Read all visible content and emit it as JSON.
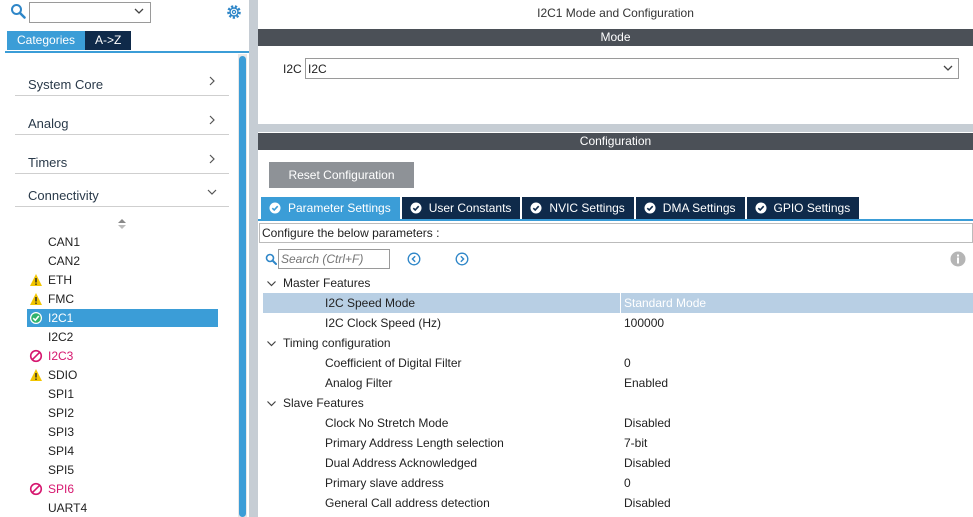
{
  "left_panel": {
    "search_value": "",
    "tabs": [
      "Categories",
      "A->Z"
    ],
    "categories": [
      {
        "label": "System Core",
        "expanded": false
      },
      {
        "label": "Analog",
        "expanded": false
      },
      {
        "label": "Timers",
        "expanded": false
      },
      {
        "label": "Connectivity",
        "expanded": true
      }
    ],
    "peripherals": [
      {
        "name": "CAN1",
        "status": "none"
      },
      {
        "name": "CAN2",
        "status": "none"
      },
      {
        "name": "ETH",
        "status": "warning"
      },
      {
        "name": "FMC",
        "status": "warning"
      },
      {
        "name": "I2C1",
        "status": "ok"
      },
      {
        "name": "I2C2",
        "status": "none"
      },
      {
        "name": "I2C3",
        "status": "error"
      },
      {
        "name": "SDIO",
        "status": "warning"
      },
      {
        "name": "SPI1",
        "status": "none"
      },
      {
        "name": "SPI2",
        "status": "none"
      },
      {
        "name": "SPI3",
        "status": "none"
      },
      {
        "name": "SPI4",
        "status": "none"
      },
      {
        "name": "SPI5",
        "status": "none"
      },
      {
        "name": "SPI6",
        "status": "error"
      },
      {
        "name": "UART4",
        "status": "none"
      }
    ]
  },
  "right_panel": {
    "title": "I2C1 Mode and Configuration",
    "mode_header": "Mode",
    "i2c_label": "I2C",
    "i2c_value": "I2C",
    "config_header": "Configuration",
    "reset_button": "Reset Configuration",
    "config_tabs": [
      "Parameter Settings",
      "User Constants",
      "NVIC Settings",
      "DMA Settings",
      "GPIO Settings"
    ],
    "config_hint": "Configure the below parameters :",
    "search_placeholder": "Search (Ctrl+F)",
    "groups": [
      {
        "name": "Master Features",
        "params": [
          {
            "name": "I2C Speed Mode",
            "value": "Standard Mode"
          },
          {
            "name": "I2C Clock Speed (Hz)",
            "value": "100000"
          }
        ]
      },
      {
        "name": "Timing configuration",
        "params": [
          {
            "name": "Coefficient of Digital Filter",
            "value": "0"
          },
          {
            "name": "Analog Filter",
            "value": "Enabled"
          }
        ]
      },
      {
        "name": "Slave Features",
        "params": [
          {
            "name": "Clock No Stretch Mode",
            "value": "Disabled"
          },
          {
            "name": "Primary Address Length selection",
            "value": "7-bit"
          },
          {
            "name": "Dual Address Acknowledged",
            "value": "Disabled"
          },
          {
            "name": "Primary slave address",
            "value": "0"
          },
          {
            "name": "General Call address detection",
            "value": "Disabled"
          }
        ]
      }
    ]
  },
  "colors": {
    "accent": "#3b9dd7",
    "dark_tab": "#0f2a4a",
    "header_band": "#4b5057",
    "warning": "#f2c500",
    "error": "#d6176f",
    "selected_row": "#b8cfe4"
  }
}
